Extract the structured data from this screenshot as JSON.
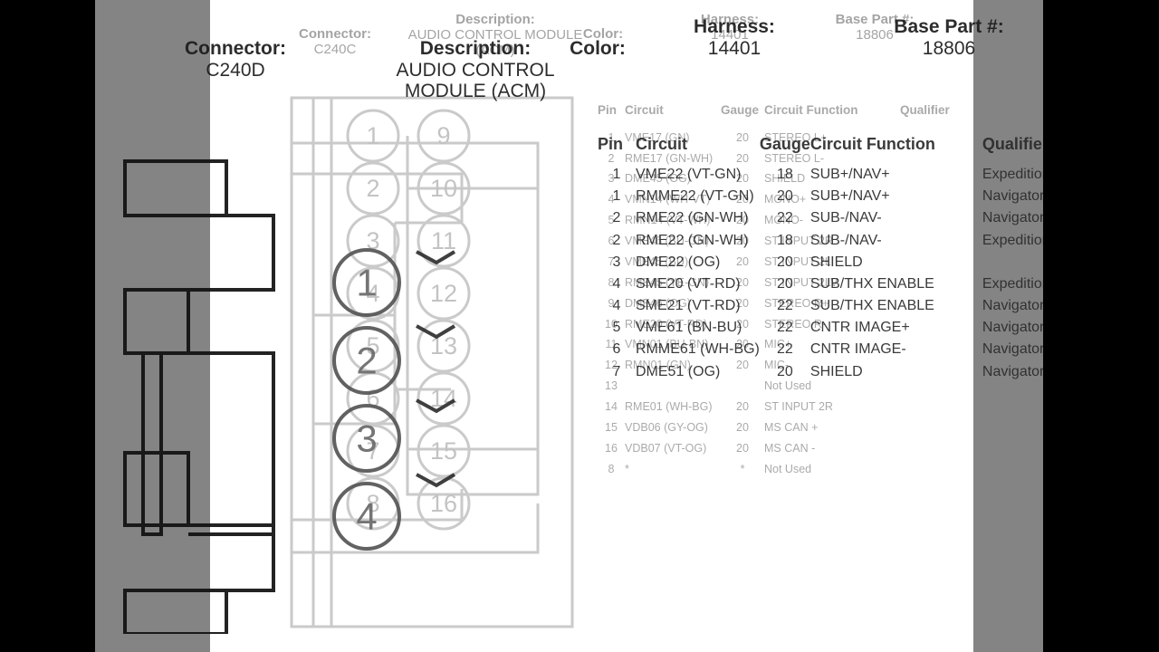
{
  "frame": {
    "letterbox_color": "#000000",
    "wash_color": "#848484",
    "paper_color": "#ffffff"
  },
  "slide_out": {
    "header": {
      "connector_label": "Connector:",
      "connector_value": "C240C",
      "description_label": "Description:",
      "description_value": "AUDIO CONTROL MODULE (ACM)",
      "color_label": "Color:",
      "color_value": "",
      "harness_label": "Harness:",
      "harness_value": "14401",
      "base_part_label": "Base Part #:",
      "base_part_value": "18806"
    },
    "table": {
      "columns": [
        "Pin",
        "Circuit",
        "Gauge",
        "Circuit Function",
        "Qualifier"
      ],
      "rows": [
        [
          "1",
          "VME17 (GN)",
          "20",
          "STEREO L+",
          ""
        ],
        [
          "2",
          "RME17 (GN-WH)",
          "20",
          "STEREO L-",
          ""
        ],
        [
          "3",
          "DME45 (OG)",
          "20",
          "SHIELD",
          ""
        ],
        [
          "4",
          "VMN14 (WH-VT)",
          "20",
          "MONO+",
          ""
        ],
        [
          "5",
          "RMN14 (VT-WH)",
          "20",
          "MONO-",
          ""
        ],
        [
          "6",
          "VME46 (BU-GN)",
          "20",
          "ST INPUT 2R",
          ""
        ],
        [
          "7",
          "VME45 (BU)",
          "20",
          "ST INPUT 2L",
          ""
        ],
        [
          "8",
          "RME45 (YE-GN)",
          "20",
          "ST INPUT 2LV",
          ""
        ],
        [
          "9",
          "DME46 (OG)",
          "20",
          "STEREO R+",
          ""
        ],
        [
          "10",
          "RME20 (VT-RD)",
          "20",
          "STEREO R-",
          ""
        ],
        [
          "11",
          "VMN01 (BU-BN)",
          "20",
          "MIC+",
          ""
        ],
        [
          "12",
          "RMN01 (GN)",
          "20",
          "MIC-",
          ""
        ],
        [
          "13",
          "",
          "",
          "Not Used",
          ""
        ],
        [
          "14",
          "RME01 (WH-BG)",
          "20",
          "ST INPUT 2R",
          ""
        ],
        [
          "15",
          "VDB06 (GY-OG)",
          "20",
          "MS CAN +",
          ""
        ],
        [
          "16",
          "VDB07 (VT-OG)",
          "20",
          "MS CAN -",
          ""
        ],
        [
          "8",
          "*",
          "*",
          "Not Used",
          ""
        ]
      ]
    },
    "diagram": {
      "type": "16-pin-two-column",
      "pins": [
        "1",
        "2",
        "3",
        "4",
        "5",
        "6",
        "7",
        "8",
        "9",
        "10",
        "11",
        "12",
        "13",
        "14",
        "15",
        "16"
      ]
    }
  },
  "slide_in": {
    "header": {
      "connector_label": "Connector:",
      "connector_value": "C240D",
      "description_label": "Description:",
      "description_value": "AUDIO CONTROL MODULE (ACM)",
      "color_label": "Color:",
      "color_value": "",
      "harness_label": "Harness:",
      "harness_value": "14401",
      "base_part_label": "Base Part #:",
      "base_part_value": "18806"
    },
    "table": {
      "columns": [
        "Pin",
        "Circuit",
        "Gauge",
        "Circuit Function",
        "Qualifier"
      ],
      "rows": [
        [
          "1",
          "VME22 (VT-GN)",
          "18",
          "SUB+/NAV+",
          "Expedition"
        ],
        [
          "1",
          "RMME22 (VT-GN)",
          "20",
          "SUB+/NAV+",
          "Navigator"
        ],
        [
          "2",
          "RME22 (GN-WH)",
          "22",
          "SUB-/NAV-",
          "Navigator"
        ],
        [
          "2",
          "RME22 (GN-WH)",
          "18",
          "SUB-/NAV-",
          "Expedition"
        ],
        [
          "3",
          "DME22 (OG)",
          "20",
          "SHIELD",
          ""
        ],
        [
          "4",
          "SME20 (VT-RD)",
          "20",
          "SUB/THX ENABLE",
          "Expedition"
        ],
        [
          "4",
          "SME21 (VT-RD)",
          "22",
          "SUB/THX ENABLE",
          "Navigator"
        ],
        [
          "5",
          "VME61 (BN-BU)",
          "22",
          "CNTR IMAGE+",
          "Navigator"
        ],
        [
          "6",
          "RMME61 (WH-BG)",
          "22",
          "CNTR IMAGE-",
          "Navigator"
        ],
        [
          "7",
          "DME51 (OG)",
          "20",
          "SHIELD",
          "Navigator"
        ]
      ]
    },
    "diagram": {
      "type": "8-pin-single-column-plus-4",
      "pins_main": [
        "1",
        "2",
        "3",
        "4",
        "5",
        "6",
        "7",
        "8"
      ],
      "pins_side": [
        "1",
        "2",
        "3",
        "4"
      ]
    }
  }
}
